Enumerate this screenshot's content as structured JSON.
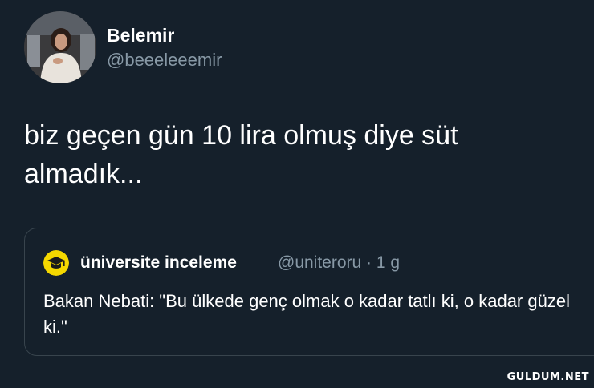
{
  "author": {
    "display_name": "Belemir",
    "handle": "@beeeleeemir",
    "avatar_icon": "profile-photo"
  },
  "tweet": {
    "text": "biz geçen gün 10 lira olmuş diye süt almadık..."
  },
  "quoted_tweet": {
    "display_name": "üniversite inceleme",
    "handle": "@uniteroru",
    "separator": "·",
    "age": "1 g",
    "text": "Bakan Nebati: \"Bu ülkede genç olmak o kadar tatlı ki, o kadar güzel ki.\"",
    "avatar_icon": "graduation-cap-icon",
    "avatar_color": "#f5d800"
  },
  "watermark": {
    "text": "GULDUM.NET"
  },
  "colors": {
    "background": "#15202b",
    "secondary_text": "#8899a6",
    "border": "#38444d"
  }
}
